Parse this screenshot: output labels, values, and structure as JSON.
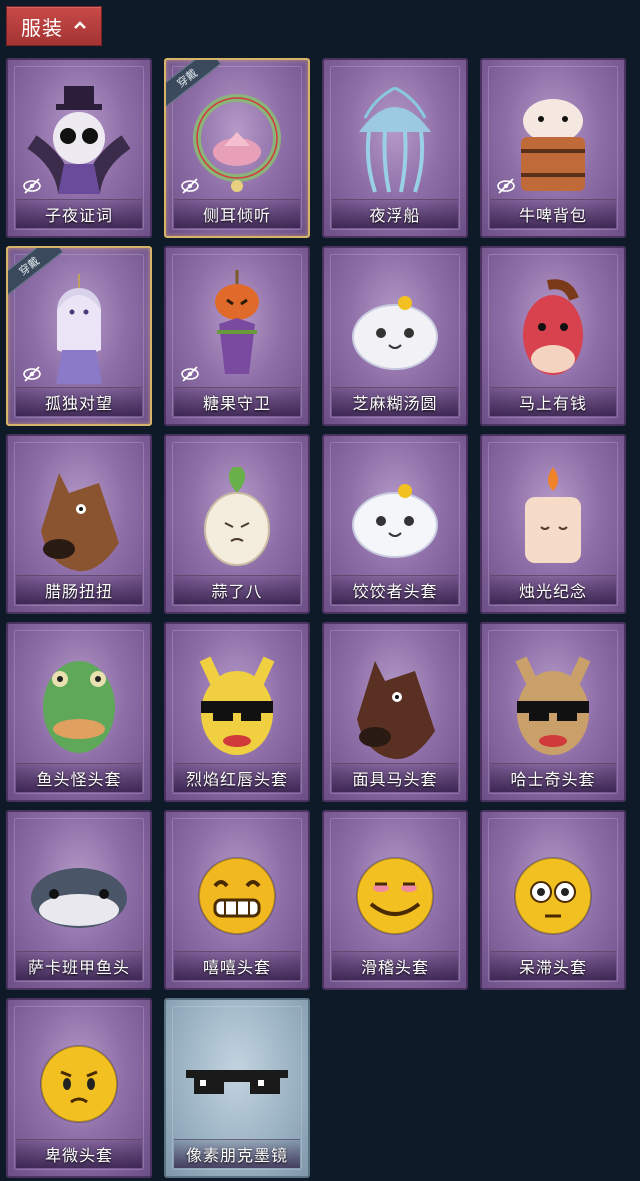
{
  "header": {
    "title": "服装",
    "chevron_icon": "chevron-up-icon"
  },
  "worn_label": "穿戴",
  "items": [
    {
      "name": "子夜证词",
      "worn": false,
      "hidden_icon": true,
      "art": "owl",
      "color": "#3a2c4a"
    },
    {
      "name": "侧耳倾听",
      "worn": true,
      "hidden_icon": true,
      "art": "wreath",
      "color": "#e8a0b8"
    },
    {
      "name": "夜浮船",
      "worn": false,
      "hidden_icon": false,
      "art": "jelly",
      "color": "#9ad0e6"
    },
    {
      "name": "牛啤背包",
      "worn": false,
      "hidden_icon": true,
      "art": "barrel",
      "color": "#c06a3a"
    },
    {
      "name": "孤独对望",
      "worn": true,
      "hidden_icon": true,
      "art": "doll",
      "color": "#d8d2ea"
    },
    {
      "name": "糖果守卫",
      "worn": false,
      "hidden_icon": true,
      "art": "pumpkin",
      "color": "#e06a2a"
    },
    {
      "name": "芝麻糊汤圆",
      "worn": false,
      "hidden_icon": false,
      "art": "dumpling",
      "color": "#f2f2f6"
    },
    {
      "name": "马上有钱",
      "worn": false,
      "hidden_icon": false,
      "art": "horse",
      "color": "#d8424e"
    },
    {
      "name": "腊肠扭扭",
      "worn": false,
      "hidden_icon": false,
      "art": "dog",
      "color": "#8a5430"
    },
    {
      "name": "蒜了八",
      "worn": false,
      "hidden_icon": false,
      "art": "garlic",
      "color": "#f4ecdc"
    },
    {
      "name": "饺饺者头套",
      "worn": false,
      "hidden_icon": false,
      "art": "cloud",
      "color": "#f4f6fa"
    },
    {
      "name": "烛光纪念",
      "worn": false,
      "hidden_icon": false,
      "art": "candle",
      "color": "#f6dcc8"
    },
    {
      "name": "鱼头怪头套",
      "worn": false,
      "hidden_icon": false,
      "art": "fish",
      "color": "#5fa85a"
    },
    {
      "name": "烈焰红唇头套",
      "worn": false,
      "hidden_icon": false,
      "art": "yellow",
      "color": "#f0d040"
    },
    {
      "name": "面具马头套",
      "worn": false,
      "hidden_icon": false,
      "art": "horsehead",
      "color": "#5a3022"
    },
    {
      "name": "哈士奇头套",
      "worn": false,
      "hidden_icon": false,
      "art": "husky",
      "color": "#c9a06a"
    },
    {
      "name": "萨卡班甲鱼头",
      "worn": false,
      "hidden_icon": false,
      "art": "sacaban",
      "color": "#4a5668"
    },
    {
      "name": "嘻嘻头套",
      "worn": false,
      "hidden_icon": false,
      "art": "grin",
      "color": "#f2b820"
    },
    {
      "name": "滑稽头套",
      "worn": false,
      "hidden_icon": false,
      "art": "funny",
      "color": "#f2c020"
    },
    {
      "name": "呆滞头套",
      "worn": false,
      "hidden_icon": false,
      "art": "dazed",
      "color": "#f2c020"
    },
    {
      "name": "卑微头套",
      "worn": false,
      "hidden_icon": false,
      "art": "humble",
      "color": "#f2c020"
    },
    {
      "name": "像素朋克墨镜",
      "worn": false,
      "hidden_icon": false,
      "art": "glasses",
      "color": "#1a1a1a",
      "blue": true
    }
  ]
}
